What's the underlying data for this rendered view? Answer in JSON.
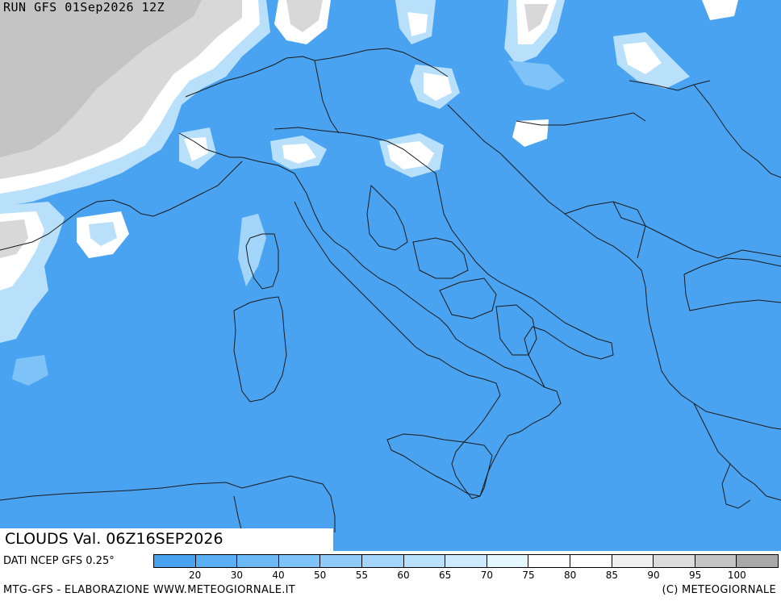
{
  "map": {
    "run_label": "RUN GFS 01Sep2026 12Z",
    "title": "CLOUDS Val. 06Z16SEP2026",
    "source": "DATI NCEP GFS 0.25°",
    "footer_left": "MTG-GFS - ELABORAZIONE WWW.METEOGIORNALE.IT",
    "footer_right": "(C) METEOGIORNALE",
    "base_cloud_color": "#4aa3f0",
    "border_color": "#1a1a1a"
  },
  "legend": {
    "colors": [
      "#4aa3f0",
      "#5aaff4",
      "#6bb8f5",
      "#7dc3f7",
      "#8fcbf8",
      "#a3d5fa",
      "#b8e0fb",
      "#cdeafc",
      "#e3f7fe",
      "#ffffff",
      "#ffffff",
      "#f0f0f0",
      "#dcdcdc",
      "#c4c4c4",
      "#a8a8a8"
    ],
    "labels": [
      "20",
      "30",
      "40",
      "50",
      "55",
      "60",
      "65",
      "70",
      "75",
      "80",
      "85",
      "90",
      "95",
      "100"
    ]
  }
}
